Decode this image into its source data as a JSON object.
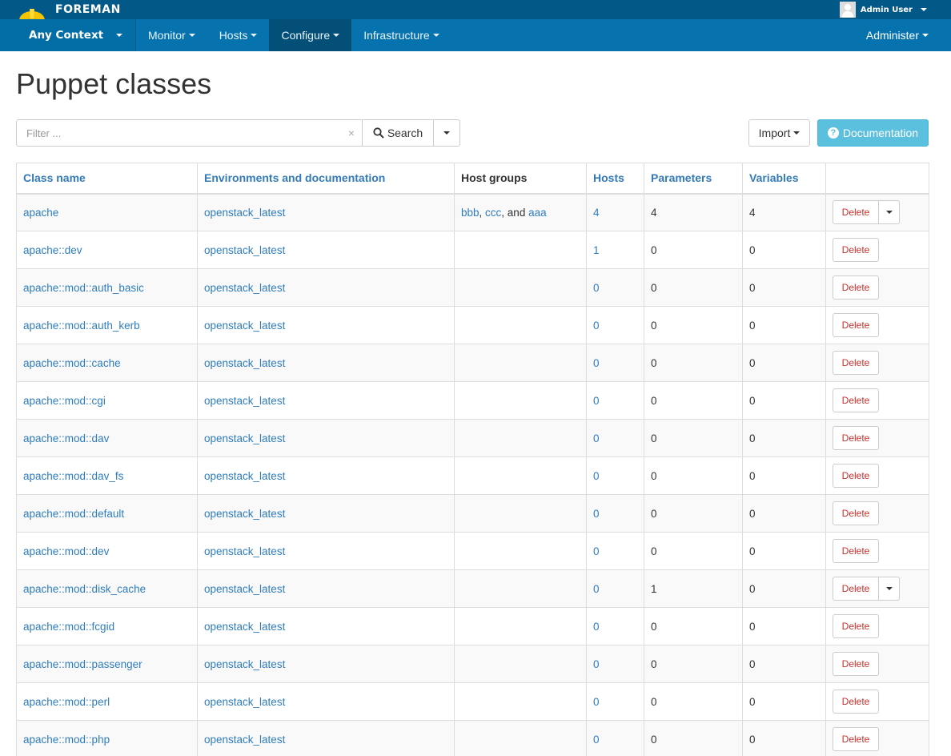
{
  "header": {
    "brand": "FOREMAN",
    "user": "Admin User"
  },
  "nav": {
    "context": "Any Context",
    "items": [
      {
        "label": "Monitor"
      },
      {
        "label": "Hosts"
      },
      {
        "label": "Configure",
        "active": true
      },
      {
        "label": "Infrastructure"
      }
    ],
    "right": "Administer"
  },
  "page": {
    "title": "Puppet classes",
    "filter_placeholder": "Filter ...",
    "search_label": "Search",
    "import_label": "Import",
    "doc_label": "Documentation"
  },
  "table": {
    "headers": [
      "Class name",
      "Environments and documentation",
      "Host groups",
      "Hosts",
      "Parameters",
      "Variables",
      ""
    ],
    "delete_label": "Delete",
    "rows": [
      {
        "name": "apache",
        "env": "openstack_latest",
        "hostgroups": [
          {
            "t": "bbb",
            "link": true
          },
          {
            "t": ", ",
            "link": false
          },
          {
            "t": "ccc",
            "link": true
          },
          {
            "t": ", and ",
            "link": false
          },
          {
            "t": "aaa",
            "link": true
          }
        ],
        "hosts": "4",
        "params": "4",
        "vars": "4",
        "split": true
      },
      {
        "name": "apache::dev",
        "env": "openstack_latest",
        "hostgroups": [],
        "hosts": "1",
        "params": "0",
        "vars": "0",
        "split": false
      },
      {
        "name": "apache::mod::auth_basic",
        "env": "openstack_latest",
        "hostgroups": [],
        "hosts": "0",
        "params": "0",
        "vars": "0",
        "split": false
      },
      {
        "name": "apache::mod::auth_kerb",
        "env": "openstack_latest",
        "hostgroups": [],
        "hosts": "0",
        "params": "0",
        "vars": "0",
        "split": false
      },
      {
        "name": "apache::mod::cache",
        "env": "openstack_latest",
        "hostgroups": [],
        "hosts": "0",
        "params": "0",
        "vars": "0",
        "split": false
      },
      {
        "name": "apache::mod::cgi",
        "env": "openstack_latest",
        "hostgroups": [],
        "hosts": "0",
        "params": "0",
        "vars": "0",
        "split": false
      },
      {
        "name": "apache::mod::dav",
        "env": "openstack_latest",
        "hostgroups": [],
        "hosts": "0",
        "params": "0",
        "vars": "0",
        "split": false
      },
      {
        "name": "apache::mod::dav_fs",
        "env": "openstack_latest",
        "hostgroups": [],
        "hosts": "0",
        "params": "0",
        "vars": "0",
        "split": false
      },
      {
        "name": "apache::mod::default",
        "env": "openstack_latest",
        "hostgroups": [],
        "hosts": "0",
        "params": "0",
        "vars": "0",
        "split": false
      },
      {
        "name": "apache::mod::dev",
        "env": "openstack_latest",
        "hostgroups": [],
        "hosts": "0",
        "params": "0",
        "vars": "0",
        "split": false
      },
      {
        "name": "apache::mod::disk_cache",
        "env": "openstack_latest",
        "hostgroups": [],
        "hosts": "0",
        "params": "1",
        "vars": "0",
        "split": true
      },
      {
        "name": "apache::mod::fcgid",
        "env": "openstack_latest",
        "hostgroups": [],
        "hosts": "0",
        "params": "0",
        "vars": "0",
        "split": false
      },
      {
        "name": "apache::mod::passenger",
        "env": "openstack_latest",
        "hostgroups": [],
        "hosts": "0",
        "params": "0",
        "vars": "0",
        "split": false
      },
      {
        "name": "apache::mod::perl",
        "env": "openstack_latest",
        "hostgroups": [],
        "hosts": "0",
        "params": "0",
        "vars": "0",
        "split": false
      },
      {
        "name": "apache::mod::php",
        "env": "openstack_latest",
        "hostgroups": [],
        "hosts": "0",
        "params": "0",
        "vars": "0",
        "split": false
      }
    ]
  },
  "colors": {
    "topbar": "#025987",
    "navbar": "#0673ae",
    "link": "#2f7dbd",
    "delete": "#c9302c",
    "doc_button": "#5bc0de"
  }
}
